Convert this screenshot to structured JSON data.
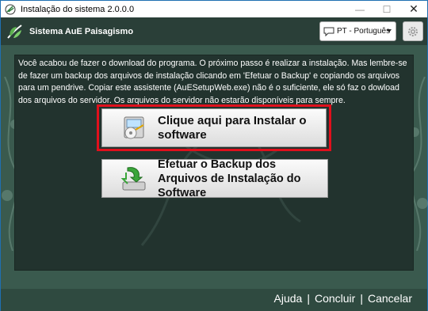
{
  "window": {
    "title": "Instalação do sistema 2.0.0.0",
    "controls": {
      "minimize": "—",
      "maximize": "☐",
      "close": "✕"
    }
  },
  "header": {
    "brand": "Sistema AuE Paisagismo",
    "language": {
      "selected": "PT - Português"
    },
    "settings_icon": "gear-icon"
  },
  "main": {
    "message": "Você acabou de fazer o download do programa. O próximo passo é realizar a instalação. Mas lembre-se de fazer um backup dos arquivos de instalação clicando em 'Efetuar o Backup' e copiando os arquivos para um pendrive. Copiar este assistente (AuESetupWeb.exe) não é o suficiente, ele só faz o dowload dos arquivos do servidor. Os arquivos do servidor não estarão disponíveis para sempre.",
    "install_button": {
      "label": "Clique aqui para Instalar o software",
      "icon": "installer-icon"
    },
    "backup_button": {
      "label": "Efetuar o Backup dos Arquivos de Instalação do Software",
      "icon": "backup-icon"
    }
  },
  "footer": {
    "help": "Ajuda",
    "finish": "Concluir",
    "cancel": "Cancelar",
    "separator": "|"
  },
  "colors": {
    "highlight": "#e0101c",
    "panel": "#22332e",
    "background": "#3a5a4e"
  }
}
